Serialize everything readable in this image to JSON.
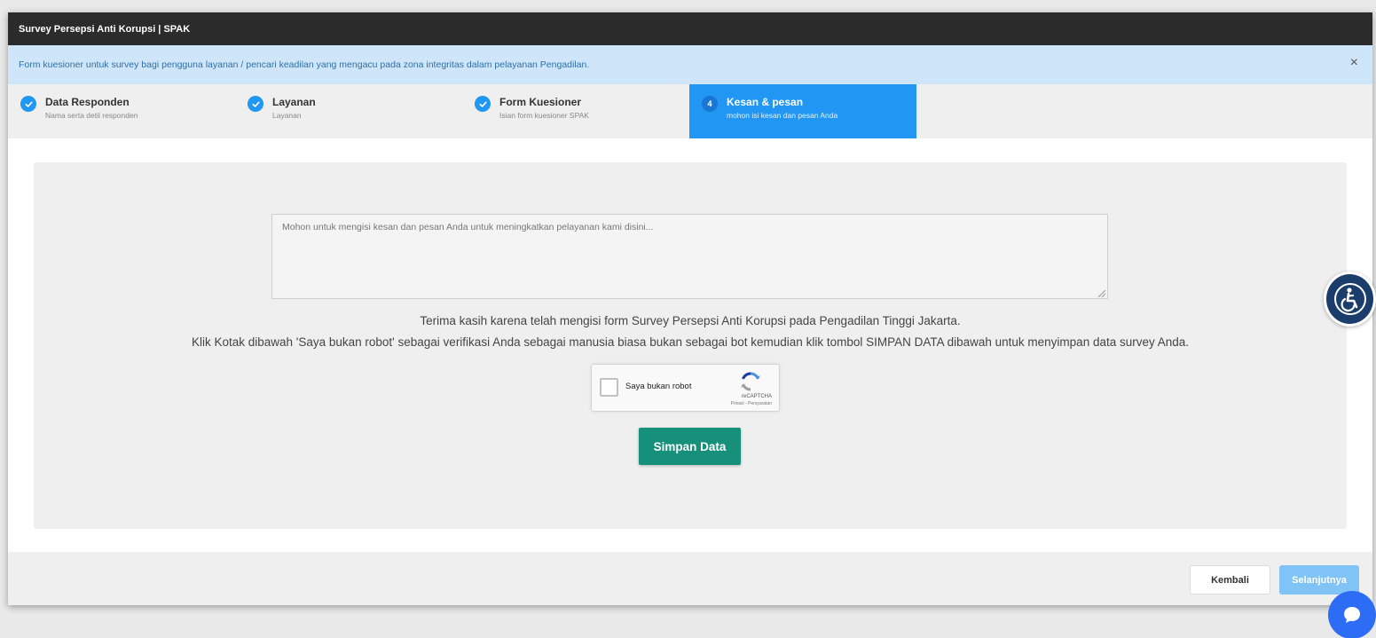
{
  "window": {
    "title": "Survey Persepsi Anti Korupsi | SPAK"
  },
  "alert": {
    "text": "Form kuesioner untuk survey bagi pengguna layanan / pencari keadilan yang mengacu pada zona integritas dalam pelayanan Pengadilan.",
    "close_glyph": "×"
  },
  "steps": [
    {
      "title": "Data Responden",
      "subtitle": "Nama serta detil responden",
      "state": "completed"
    },
    {
      "title": "Layanan",
      "subtitle": "Layanan",
      "state": "completed"
    },
    {
      "title": "Form Kuesioner",
      "subtitle": "Isian form kuesioner SPAK",
      "state": "completed"
    },
    {
      "number": "4",
      "title": "Kesan & pesan",
      "subtitle": "mohon isi kesan dan pesan Anda",
      "state": "active"
    }
  ],
  "form": {
    "message_placeholder": "Mohon untuk mengisi kesan dan pesan Anda untuk meningkatkan pelayanan kami disini...",
    "message_value": "",
    "thanks_text": "Terima kasih karena telah mengisi form Survey Persepsi Anti Korupsi pada Pengadilan Tinggi Jakarta.",
    "instruction_text": "Klik Kotak dibawah 'Saya bukan robot' sebagai verifikasi Anda sebagai manusia biasa bukan sebagai bot kemudian klik tombol SIMPAN DATA dibawah untuk menyimpan data survey Anda.",
    "recaptcha": {
      "label": "Saya bukan robot",
      "brand": "reCAPTCHA",
      "terms": "Privasi - Persyaratan",
      "checked": false
    },
    "save_label": "Simpan Data"
  },
  "footer": {
    "back_label": "Kembali",
    "next_label": "Selanjutnya"
  },
  "colors": {
    "accent": "#2196f3",
    "save": "#17907b",
    "titlebar": "#2b2b2b",
    "alert_bg": "#cfe6fa",
    "next_disabled": "#7fc3f7"
  },
  "icons": {
    "step_done": "check-circle-icon",
    "accessibility": "accessibility-icon",
    "chat": "chat-icon",
    "recaptcha": "recaptcha-logo-icon"
  }
}
